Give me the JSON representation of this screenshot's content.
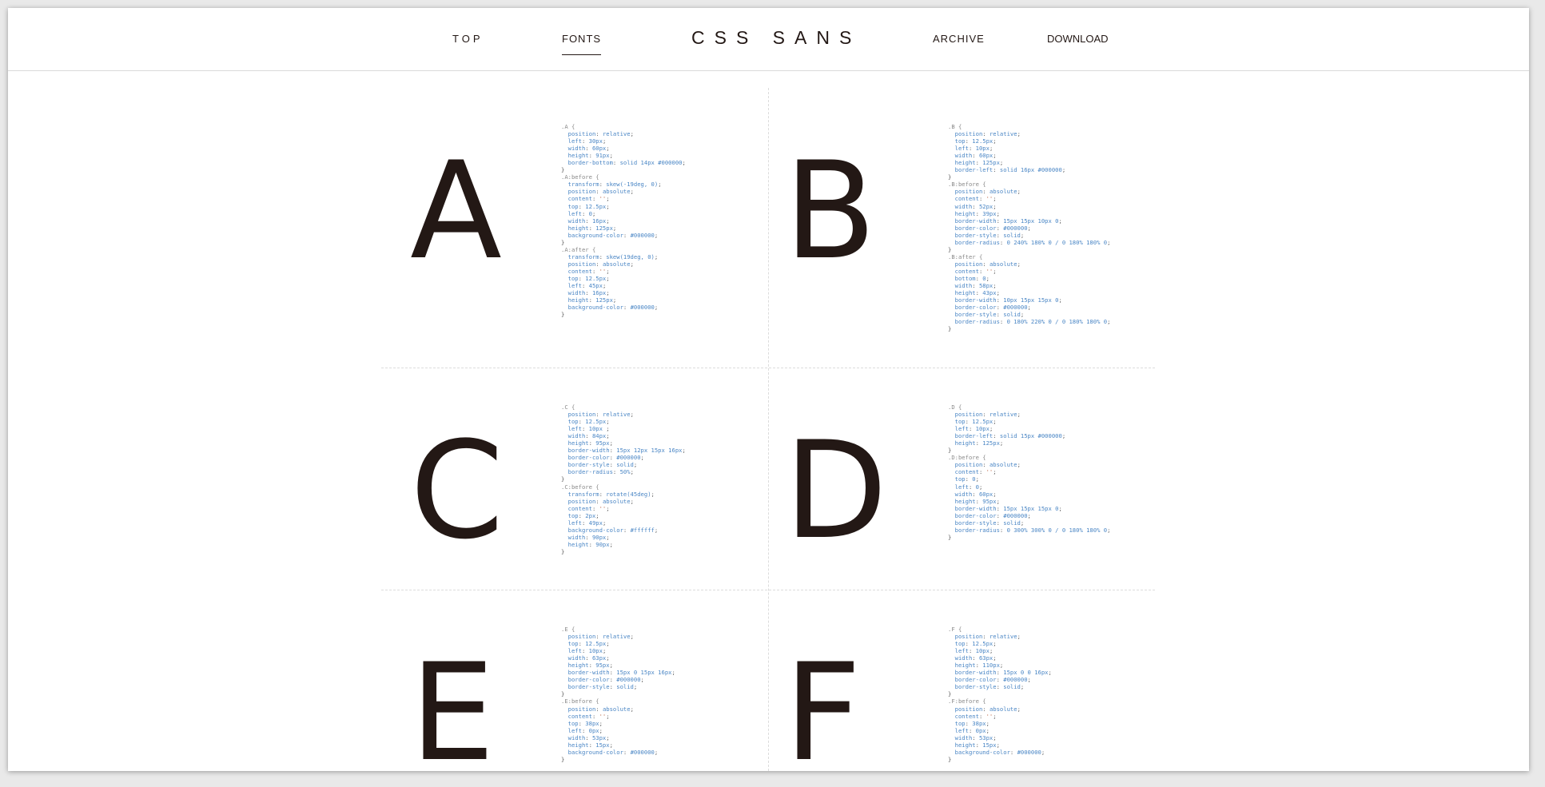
{
  "nav": {
    "top": "TOP",
    "fonts": "FONTS",
    "archive": "ARCHIVE",
    "download": "DOWNLOAD"
  },
  "site_title": "CSS SANS",
  "colors": {
    "ink": "#231815",
    "code_prop": "#4a86c5",
    "divider": "#dcdcdc"
  },
  "glyphs": [
    {
      "letter": "A",
      "code": ".A {\n  position: relative;\n  left: 30px;\n  width: 60px;\n  height: 91px;\n  border-bottom: solid 14px #000000;\n}\n.A:before {\n  transform: skew(-19deg, 0);\n  position: absolute;\n  content: '';\n  top: 12.5px;\n  left: 0;\n  width: 16px;\n  height: 125px;\n  background-color: #000000;\n}\n.A:after {\n  transform: skew(19deg, 0);\n  position: absolute;\n  content: '';\n  top: 12.5px;\n  left: 45px;\n  width: 16px;\n  height: 125px;\n  background-color: #000000;\n}"
    },
    {
      "letter": "B",
      "code": ".B {\n  position: relative;\n  top: 12.5px;\n  left: 10px;\n  width: 60px;\n  height: 125px;\n  border-left: solid 16px #000000;\n}\n.B:before {\n  position: absolute;\n  content: '';\n  width: 52px;\n  height: 39px;\n  border-width: 15px 15px 10px 0;\n  border-color: #000000;\n  border-style: solid;\n  border-radius: 0 240% 180% 0 / 0 180% 180% 0;\n}\n.B:after {\n  position: absolute;\n  content: '';\n  bottom: 0;\n  width: 58px;\n  height: 43px;\n  border-width: 10px 15px 15px 0;\n  border-color: #000000;\n  border-style: solid;\n  border-radius: 0 180% 220% 0 / 0 180% 180% 0;\n}"
    },
    {
      "letter": "C",
      "code": ".C {\n  position: relative;\n  top: 12.5px;\n  left: 10px ;\n  width: 84px;\n  height: 95px;\n  border-width: 15px 12px 15px 16px;\n  border-color: #000000;\n  border-style: solid;\n  border-radius: 50%;\n}\n.C:before {\n  transform: rotate(45deg);\n  position: absolute;\n  content: '';\n  top: 2px;\n  left: 49px;\n  background-color: #ffffff;\n  width: 90px;\n  height: 90px;\n}"
    },
    {
      "letter": "D",
      "code": ".D {\n  position: relative;\n  top: 12.5px;\n  left: 10px;\n  border-left: solid 15px #000000;\n  height: 125px;\n}\n.D:before {\n  position: absolute;\n  content: '';\n  top: 0;\n  left: 0;\n  width: 60px;\n  height: 95px;\n  border-width: 15px 15px 15px 0;\n  border-color: #000000;\n  border-style: solid;\n  border-radius: 0 300% 300% 0 / 0 180% 180% 0;\n}"
    },
    {
      "letter": "E",
      "code": ".E {\n  position: relative;\n  top: 12.5px;\n  left: 10px;\n  width: 63px;\n  height: 95px;\n  border-width: 15px 0 15px 16px;\n  border-color: #000000;\n  border-style: solid;\n}\n.E:before {\n  position: absolute;\n  content: '';\n  top: 38px;\n  left: 0px;\n  width: 53px;\n  height: 15px;\n  background-color: #000000;\n}"
    },
    {
      "letter": "F",
      "code": ".F {\n  position: relative;\n  top: 12.5px;\n  left: 10px;\n  width: 63px;\n  height: 110px;\n  border-width: 15px 0 0 16px;\n  border-color: #000000;\n  border-style: solid;\n}\n.F:before {\n  position: absolute;\n  content: '';\n  top: 38px;\n  left: 0px;\n  width: 53px;\n  height: 15px;\n  background-color: #000000;\n}"
    }
  ]
}
